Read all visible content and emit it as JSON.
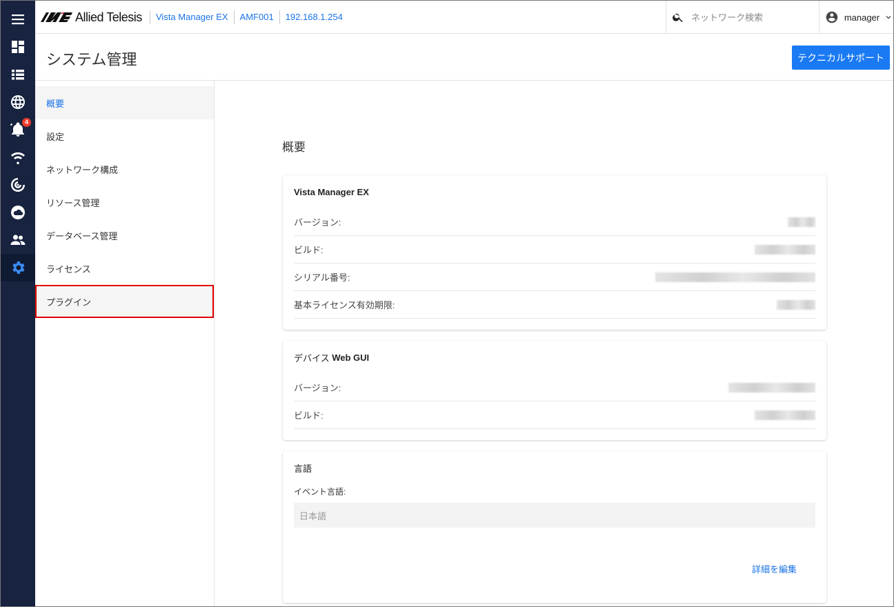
{
  "header": {
    "logo_text": "Allied Telesis",
    "breadcrumbs": [
      "Vista Manager EX",
      "AMF001",
      "192.168.1.254"
    ],
    "search_placeholder": "ネットワーク検索",
    "user_name": "manager"
  },
  "rail": {
    "items": [
      {
        "icon": "menu-icon"
      },
      {
        "icon": "dashboard-icon"
      },
      {
        "icon": "list-icon"
      },
      {
        "icon": "globe-icon"
      },
      {
        "icon": "bell-icon",
        "badge": "4"
      },
      {
        "icon": "wifi-icon"
      },
      {
        "icon": "radar-icon"
      },
      {
        "icon": "cloud-icon"
      },
      {
        "icon": "people-icon"
      },
      {
        "icon": "gear-icon",
        "active": true
      }
    ]
  },
  "page": {
    "title": "システム管理",
    "tech_support_button": "テクニカルサポート"
  },
  "menu": {
    "items": [
      "概要",
      "設定",
      "ネットワーク構成",
      "リソース管理",
      "データベース管理",
      "ライセンス",
      "プラグイン"
    ],
    "active": "概要",
    "highlighted": "プラグイン"
  },
  "content": {
    "section_title": "概要",
    "vista_card": {
      "title": "Vista Manager EX",
      "rows": [
        "バージョン:",
        "ビルド:",
        "シリアル番号:",
        "基本ライセンス有効期限:"
      ]
    },
    "device_card": {
      "title_jp": "デバイス",
      "title_en": " Web GUI",
      "rows": [
        "バージョン:",
        "ビルド:"
      ]
    },
    "language_card": {
      "title": "言語",
      "field_label": "イベント言語:",
      "field_value": "日本語",
      "edit_link": "詳細を編集"
    }
  },
  "colors": {
    "rail_bg": "#17233f",
    "accent": "#1a73e8",
    "button": "#1a7af3",
    "highlight_border": "#e00000"
  }
}
